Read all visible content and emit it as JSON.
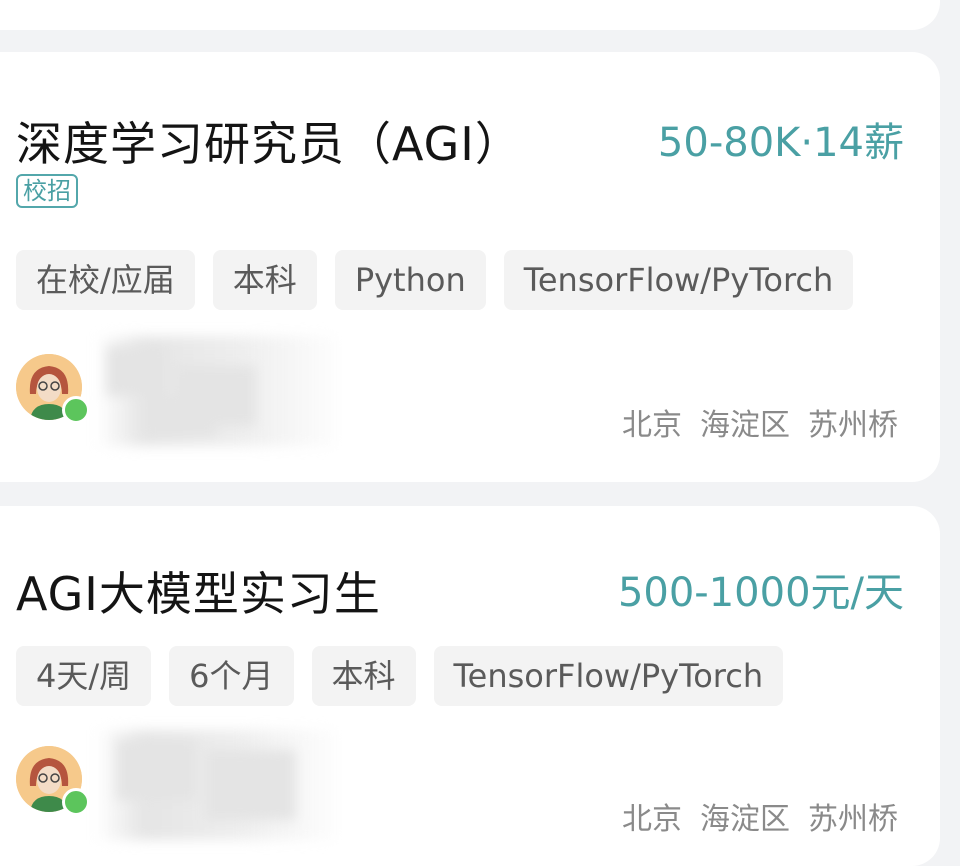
{
  "jobs": [
    {
      "title": "深度学习研究员（AGI）",
      "salary": "50-80K·14薪",
      "badge": "校招",
      "tags": [
        "在校/应届",
        "本科",
        "Python",
        "TensorFlow/PyTorch"
      ],
      "location": [
        "北京",
        "海淀区",
        "苏州桥"
      ],
      "recruiter_online": true
    },
    {
      "title": "AGI大模型实习生",
      "salary": "500-1000元/天",
      "tags": [
        "4天/周",
        "6个月",
        "本科",
        "TensorFlow/PyTorch"
      ],
      "location": [
        "北京",
        "海淀区",
        "苏州桥"
      ],
      "recruiter_online": true
    }
  ],
  "colors": {
    "salary": "#4aa0a4",
    "badge": "#53a7ab",
    "online": "#5cc55c"
  }
}
